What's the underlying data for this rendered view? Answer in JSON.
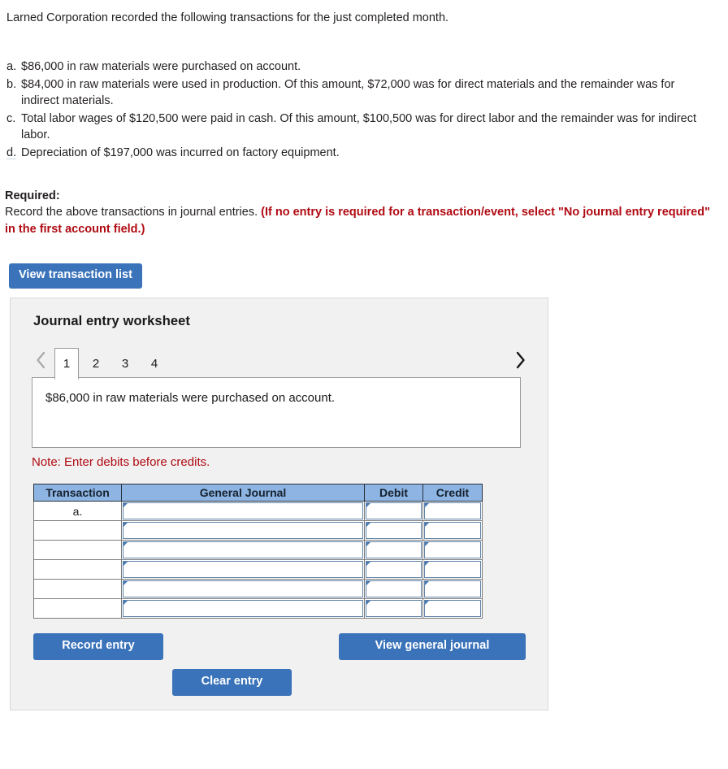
{
  "intro": "Larned Corporation recorded the following transactions for the just completed month.",
  "transactions": [
    {
      "marker": "a.",
      "text": "$86,000 in raw materials were purchased on account."
    },
    {
      "marker": "b.",
      "text": "$84,000 in raw materials were used in production. Of this amount, $72,000 was for direct materials and the remainder was for indirect materials."
    },
    {
      "marker": "c.",
      "text": "Total labor wages of $120,500 were paid in cash. Of this amount, $100,500 was for direct labor and the remainder was for indirect labor."
    },
    {
      "marker": "d.",
      "text": "Depreciation of $197,000 was incurred on factory equipment."
    }
  ],
  "required": {
    "label": "Required:",
    "body_plain": "Record the above transactions in journal entries. ",
    "body_emphasis": "(If no entry is required for a transaction/event, select \"No journal entry required\" in the first account field.)"
  },
  "view_transaction_list_label": "View transaction list",
  "worksheet": {
    "title": "Journal entry worksheet",
    "prev_arrow": "chevron-left",
    "next_arrow": "chevron-right",
    "tabs": [
      {
        "label": "1",
        "active": true
      },
      {
        "label": "2",
        "active": false
      },
      {
        "label": "3",
        "active": false
      },
      {
        "label": "4",
        "active": false
      }
    ],
    "description": "$86,000 in raw materials were purchased on account.",
    "note": "Note: Enter debits before credits.",
    "table": {
      "headers": [
        "Transaction",
        "General Journal",
        "Debit",
        "Credit"
      ],
      "rows": [
        {
          "transaction": "a.",
          "general_journal": "",
          "debit": "",
          "credit": ""
        },
        {
          "transaction": "",
          "general_journal": "",
          "debit": "",
          "credit": ""
        },
        {
          "transaction": "",
          "general_journal": "",
          "debit": "",
          "credit": ""
        },
        {
          "transaction": "",
          "general_journal": "",
          "debit": "",
          "credit": ""
        },
        {
          "transaction": "",
          "general_journal": "",
          "debit": "",
          "credit": ""
        },
        {
          "transaction": "",
          "general_journal": "",
          "debit": "",
          "credit": ""
        }
      ]
    },
    "buttons": {
      "record_entry": "Record entry",
      "clear_entry": "Clear entry",
      "view_general_journal": "View general journal"
    }
  },
  "colors": {
    "button_blue": "#3a73ba",
    "table_header_blue": "#8db4e2",
    "emphasis_red": "#b00a12",
    "panel_background": "#f1f1f1",
    "field_border_blue": "#5f83a8"
  }
}
